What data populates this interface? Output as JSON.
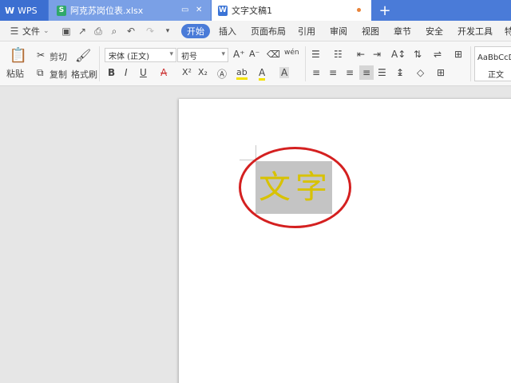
{
  "tabs": {
    "wps": {
      "label": "WPS"
    },
    "xlsx": {
      "badge": "S",
      "label": "阿克苏岗位表.xlsx"
    },
    "doc": {
      "badge": "W",
      "label": "文字文稿1"
    },
    "add": "+"
  },
  "menubar": {
    "file": "文件",
    "items": [
      "开始",
      "插入",
      "页面布局",
      "引用",
      "审阅",
      "视图",
      "章节",
      "安全",
      "开发工具",
      "特"
    ],
    "active": "开始"
  },
  "ribbon": {
    "paste": "粘贴",
    "cut": "剪切",
    "copy": "复制",
    "format_painter": "格式刷",
    "font_name": "宋体 (正文)",
    "font_size": "初号",
    "bold": "B",
    "italic": "I",
    "underline": "U",
    "strikethrough": "A",
    "superscript": "X²",
    "subscript": "X₂",
    "phonetic": "wén",
    "char_shading": "A",
    "style_preview": "AaBbCcD",
    "style_name": "正文"
  },
  "document": {
    "text": "文字"
  },
  "colors": {
    "accent": "#4a7bd8",
    "highlight_circle": "#d42020",
    "text_color": "#d8c200",
    "selection_bg": "#c4c4c4"
  },
  "icons": [
    "wps-logo-icon",
    "pin-icon",
    "close-icon",
    "hamburger-icon",
    "save-icon",
    "undo-icon",
    "redo-icon",
    "print-icon",
    "scissors-icon",
    "copy-icon",
    "brush-icon",
    "paste-icon",
    "list-icon",
    "align-icon",
    "style-icon"
  ]
}
